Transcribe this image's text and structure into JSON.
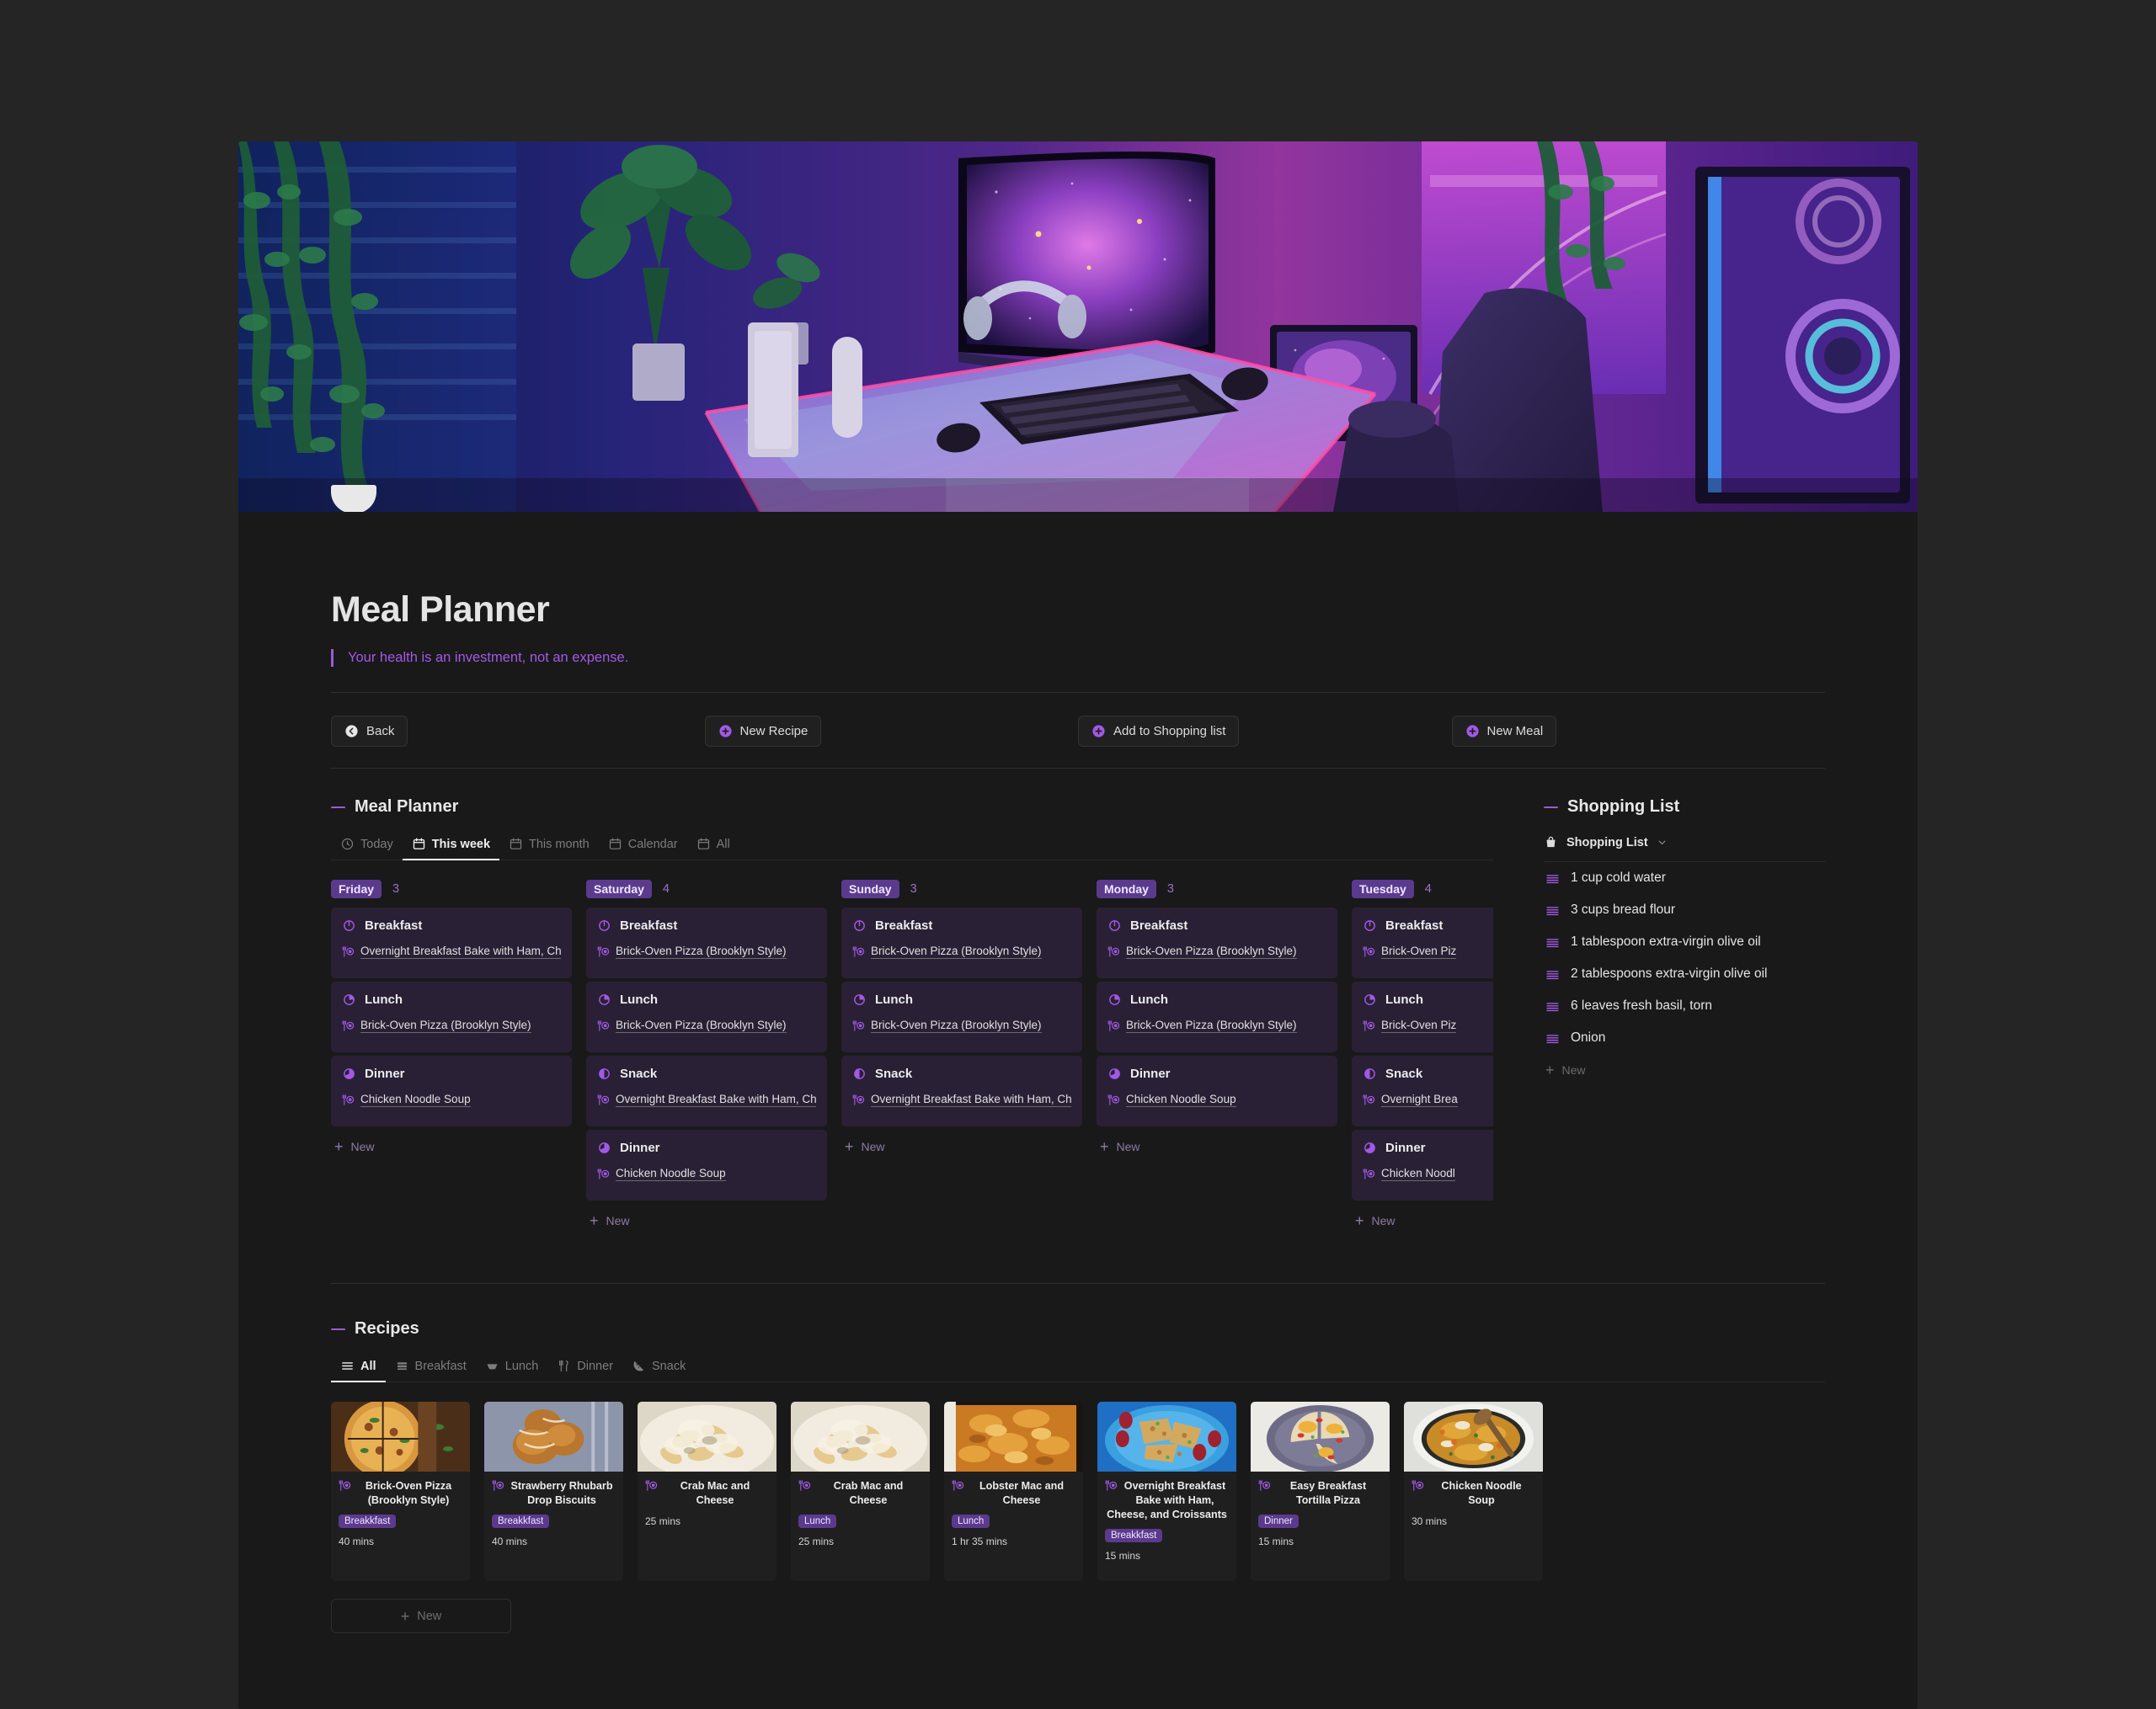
{
  "page": {
    "icon": "bowl-icon",
    "title": "Meal Planner",
    "quote": "Your health is an investment, not an expense."
  },
  "colors": {
    "accent": "#a259e6",
    "pill_bg": "#5b3a8e",
    "card_bg": "#2a2035",
    "page_bg": "#191919"
  },
  "actions": [
    {
      "label": "Back",
      "icon": "back-arrow-icon"
    },
    {
      "label": "New Recipe",
      "icon": "plus-circle-icon"
    },
    {
      "label": "Add to Shopping list",
      "icon": "plus-circle-icon"
    },
    {
      "label": "New Meal",
      "icon": "plus-circle-icon"
    }
  ],
  "planner": {
    "heading": "Meal Planner",
    "tabs": [
      {
        "label": "Today",
        "icon": "clock-icon",
        "active": false
      },
      {
        "label": "This week",
        "icon": "calendar-icon",
        "active": true
      },
      {
        "label": "This month",
        "icon": "calendar-icon",
        "active": false
      },
      {
        "label": "Calendar",
        "icon": "calendar-icon",
        "active": false
      },
      {
        "label": "All",
        "icon": "calendar-icon",
        "active": false
      }
    ],
    "new_label": "New",
    "days": [
      {
        "name": "Friday",
        "count": "3",
        "meals": [
          {
            "type": "Breakfast",
            "icon": "clock-quarter-icon",
            "recipe": "Overnight Breakfast Bake with Ham, Che"
          },
          {
            "type": "Lunch",
            "icon": "clock-half-icon",
            "recipe": "Brick-Oven Pizza (Brooklyn Style)"
          },
          {
            "type": "Dinner",
            "icon": "clock-full-icon",
            "recipe": "Chicken Noodle Soup"
          }
        ]
      },
      {
        "name": "Saturday",
        "count": "4",
        "meals": [
          {
            "type": "Breakfast",
            "icon": "clock-quarter-icon",
            "recipe": "Brick-Oven Pizza (Brooklyn Style)"
          },
          {
            "type": "Lunch",
            "icon": "clock-half-icon",
            "recipe": "Brick-Oven Pizza (Brooklyn Style)"
          },
          {
            "type": "Snack",
            "icon": "clock-three-quarter-icon",
            "recipe": "Overnight Breakfast Bake with Ham, Che"
          },
          {
            "type": "Dinner",
            "icon": "clock-full-icon",
            "recipe": "Chicken Noodle Soup"
          }
        ]
      },
      {
        "name": "Sunday",
        "count": "3",
        "meals": [
          {
            "type": "Breakfast",
            "icon": "clock-quarter-icon",
            "recipe": "Brick-Oven Pizza (Brooklyn Style)"
          },
          {
            "type": "Lunch",
            "icon": "clock-half-icon",
            "recipe": "Brick-Oven Pizza (Brooklyn Style)"
          },
          {
            "type": "Snack",
            "icon": "clock-three-quarter-icon",
            "recipe": "Overnight Breakfast Bake with Ham, Che"
          }
        ]
      },
      {
        "name": "Monday",
        "count": "3",
        "meals": [
          {
            "type": "Breakfast",
            "icon": "clock-quarter-icon",
            "recipe": "Brick-Oven Pizza (Brooklyn Style)"
          },
          {
            "type": "Lunch",
            "icon": "clock-half-icon",
            "recipe": "Brick-Oven Pizza (Brooklyn Style)"
          },
          {
            "type": "Dinner",
            "icon": "clock-full-icon",
            "recipe": "Chicken Noodle Soup"
          }
        ]
      },
      {
        "name": "Tuesday",
        "count": "4",
        "meals": [
          {
            "type": "Breakfast",
            "icon": "clock-quarter-icon",
            "recipe": "Brick-Oven Piz"
          },
          {
            "type": "Lunch",
            "icon": "clock-half-icon",
            "recipe": "Brick-Oven Piz"
          },
          {
            "type": "Snack",
            "icon": "clock-three-quarter-icon",
            "recipe": "Overnight Brea"
          },
          {
            "type": "Dinner",
            "icon": "clock-full-icon",
            "recipe": "Chicken Noodl"
          }
        ]
      }
    ]
  },
  "shopping": {
    "heading": "Shopping List",
    "source_label": "Shopping List",
    "source_icon": "bag-icon",
    "chevron": "chevron-down-icon",
    "new_label": "New",
    "items": [
      "1 cup cold water",
      "3 cups bread flour",
      "1 tablespoon extra-virgin olive oil",
      "2 tablespoons extra-virgin olive oil",
      "6 leaves fresh basil, torn",
      "Onion"
    ]
  },
  "recipes": {
    "heading": "Recipes",
    "tabs": [
      {
        "label": "All",
        "icon": "list-icon",
        "active": true
      },
      {
        "label": "Breakfast",
        "icon": "stack-icon",
        "active": false
      },
      {
        "label": "Lunch",
        "icon": "bowl-icon",
        "active": false
      },
      {
        "label": "Dinner",
        "icon": "fork-knife-icon",
        "active": false
      },
      {
        "label": "Snack",
        "icon": "pizza-slice-icon",
        "active": false
      }
    ],
    "new_label": "New",
    "cards": [
      {
        "title": "Brick-Oven Pizza (Brooklyn Style)",
        "tag": "Breakkfast",
        "time": "40 mins",
        "image": "pizza-photo"
      },
      {
        "title": "Strawberry Rhubarb Drop Biscuits",
        "tag": "Breakkfast",
        "time": "40 mins",
        "image": "biscuits-photo"
      },
      {
        "title": "Crab Mac and Cheese",
        "tag": "",
        "time": "25 mins",
        "image": "macncheese-photo"
      },
      {
        "title": "Crab Mac and Cheese",
        "tag": "Lunch",
        "time": "25 mins",
        "image": "macncheese-photo"
      },
      {
        "title": "Lobster Mac and Cheese",
        "tag": "Lunch",
        "time": "1 hr 35 mins",
        "image": "lobster-bake-photo"
      },
      {
        "title": "Overnight Breakfast Bake with Ham, Cheese, and Croissants",
        "tag": "Breakkfast",
        "time": "15 mins",
        "image": "breakfast-bake-photo"
      },
      {
        "title": "Easy Breakfast Tortilla Pizza",
        "tag": "Dinner",
        "time": "15 mins",
        "image": "tortilla-pizza-photo"
      },
      {
        "title": "Chicken Noodle Soup",
        "tag": "",
        "time": "30 mins",
        "image": "noodle-soup-photo"
      }
    ]
  }
}
